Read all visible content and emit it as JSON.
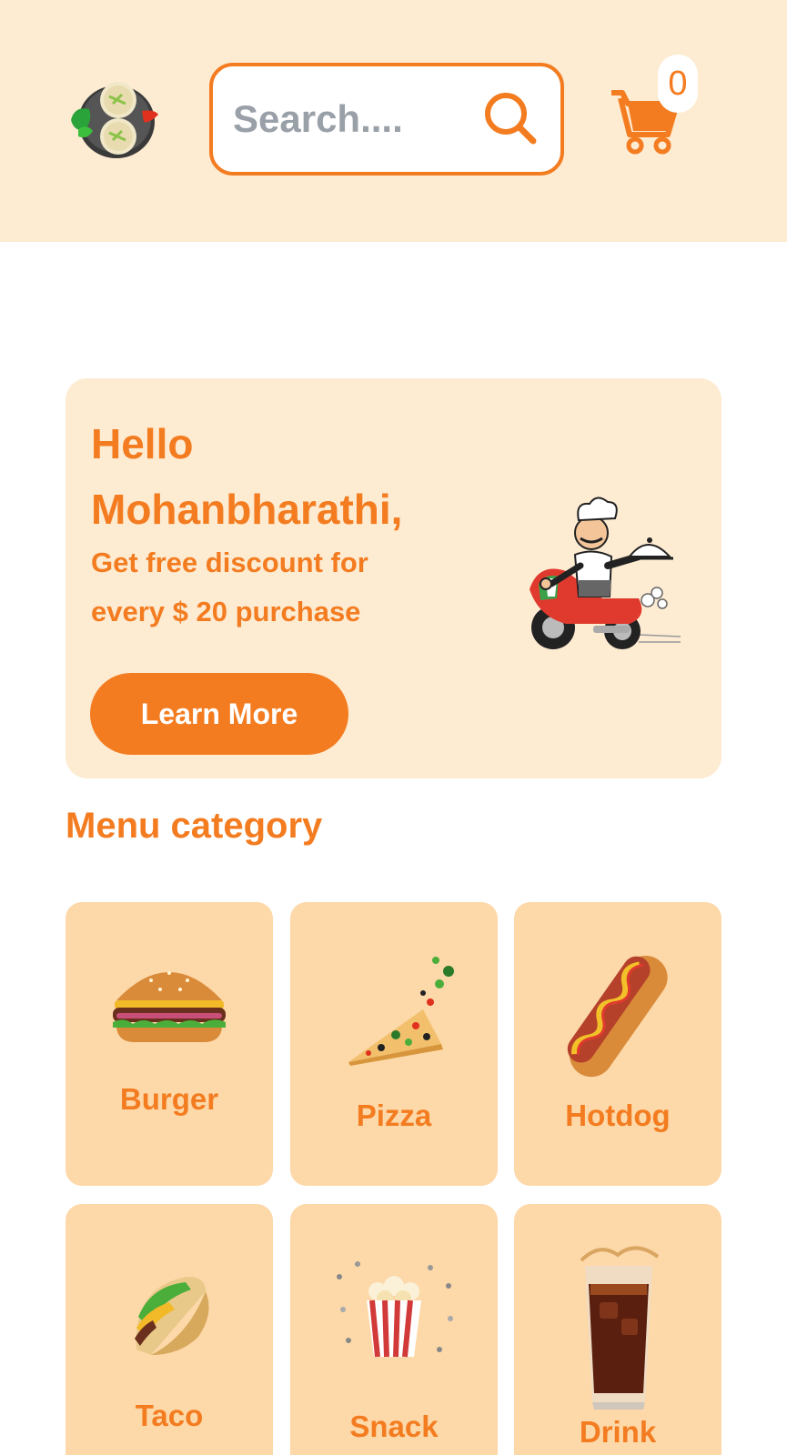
{
  "header": {
    "logo_icon": "food-plate-logo-icon",
    "search": {
      "placeholder": "Search....",
      "icon": "search-icon"
    },
    "cart": {
      "icon": "cart-icon",
      "count": "0"
    }
  },
  "promo": {
    "greeting_line1": "Hello",
    "greeting_line2": "Mohanbharathi,",
    "subtitle_line1": "Get free discount for",
    "subtitle_line2": "every $ 20 purchase",
    "button_label": "Learn More",
    "illustration": "chef-scooter-illustration"
  },
  "menu": {
    "title": "Menu category",
    "categories": [
      {
        "label": "Burger",
        "icon": "burger-icon"
      },
      {
        "label": "Pizza",
        "icon": "pizza-icon"
      },
      {
        "label": "Hotdog",
        "icon": "hotdog-icon"
      },
      {
        "label": "Taco",
        "icon": "taco-icon"
      },
      {
        "label": "Snack",
        "icon": "popcorn-icon"
      },
      {
        "label": "Drink",
        "icon": "drink-icon"
      }
    ]
  },
  "colors": {
    "accent": "#f47c20",
    "header_bg": "#fdebd2",
    "card_bg": "#fdd8a8",
    "placeholder": "#9aa0a8"
  }
}
